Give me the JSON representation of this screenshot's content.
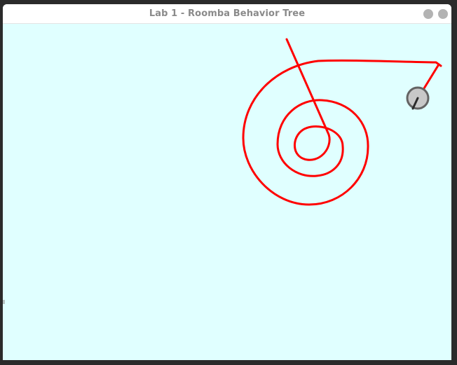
{
  "window": {
    "title": "Lab 1 - Roomba Behavior Tree",
    "buttons": [
      "minimize",
      "close"
    ]
  },
  "canvas": {
    "background": "#e0ffff",
    "trail_color": "#ff0000",
    "robot_fill": "#c8c8c8",
    "robot_stroke": "#646464",
    "heading_color": "#2b2b2b"
  }
}
